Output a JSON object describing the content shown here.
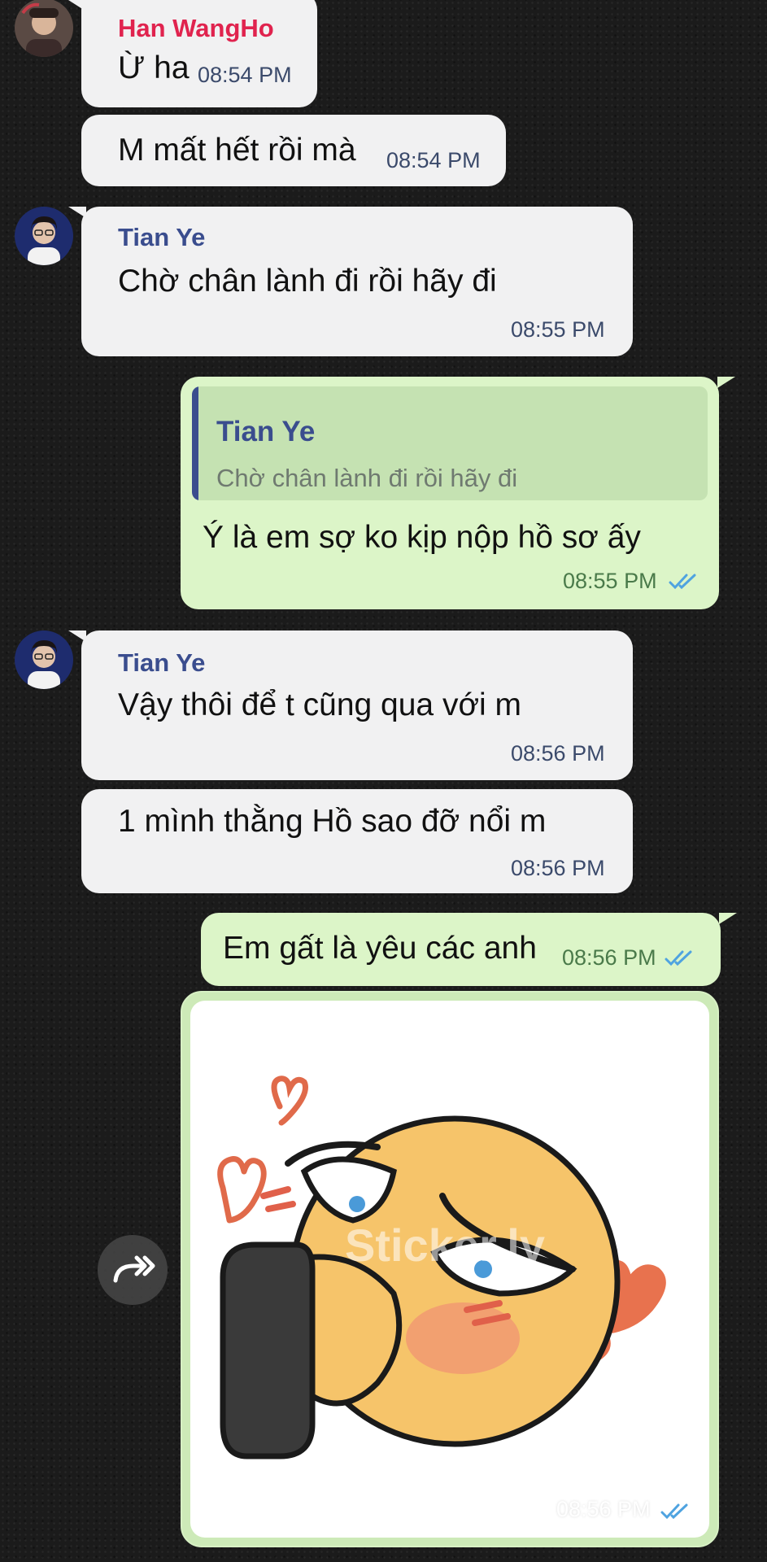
{
  "colors": {
    "incoming_bubble": "#f1f1f2",
    "outgoing_bubble": "#dcf5c8",
    "reply_box": "#c5e2b2",
    "reply_bar": "#3a4d8e",
    "sender_han": "#e0234e",
    "sender_tian": "#3a4d8e",
    "tick_blue": "#4fa3e0"
  },
  "messages": [
    {
      "sender": "Han WangHo",
      "text": "Ừ ha",
      "time": "08:54 PM"
    },
    {
      "text": "M mất hết rồi mà",
      "time": "08:54 PM"
    },
    {
      "sender": "Tian Ye",
      "text": "Chờ chân lành đi rồi hãy đi",
      "time": "08:55 PM"
    },
    {
      "reply_sender": "Tian Ye",
      "reply_text": "Chờ chân lành đi rồi hãy đi",
      "text": "Ý là em sợ ko kịp nộp hồ sơ ấy",
      "time": "08:55 PM",
      "status_icon": "double-check-icon"
    },
    {
      "sender": "Tian Ye",
      "text": "Vậy thôi để t cũng qua với m",
      "time": "08:56 PM"
    },
    {
      "text": "1 mình thằng Hồ sao đỡ nổi m",
      "time": "08:56 PM"
    },
    {
      "text": "Em gất là yêu các anh",
      "time": "08:56 PM",
      "status_icon": "double-check-icon"
    },
    {
      "type": "sticker",
      "sticker_icon": "blushing-emoji-with-phone-sticker",
      "time": "08:56 PM",
      "status_icon": "double-check-icon",
      "watermark": "Sticker.ly"
    }
  ],
  "forward_icon": "forward-arrow-icon"
}
